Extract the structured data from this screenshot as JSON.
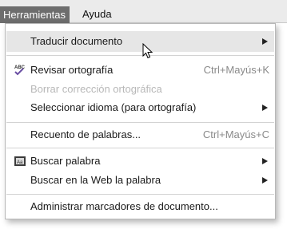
{
  "menubar": {
    "items": [
      {
        "label": "Herramientas"
      },
      {
        "label": "Ayuda"
      }
    ]
  },
  "menu": {
    "items": [
      {
        "label": "Traducir documento",
        "shortcut": "",
        "submenu": true,
        "disabled": false,
        "highlighted": true,
        "icon": ""
      },
      {
        "label": "Revisar ortografía",
        "shortcut": "Ctrl+Mayús+K",
        "submenu": false,
        "disabled": false,
        "highlighted": false,
        "icon": "spellcheck-icon",
        "icon_text": "ABC"
      },
      {
        "label": "Borrar corrección ortográfica",
        "shortcut": "",
        "submenu": false,
        "disabled": true,
        "highlighted": false,
        "icon": ""
      },
      {
        "label": "Seleccionar idioma (para ortografía)",
        "shortcut": "",
        "submenu": true,
        "disabled": false,
        "highlighted": false,
        "icon": ""
      },
      {
        "label": "Recuento de palabras...",
        "shortcut": "Ctrl+Mayús+C",
        "submenu": false,
        "disabled": false,
        "highlighted": false,
        "icon": ""
      },
      {
        "label": "Buscar palabra",
        "shortcut": "",
        "submenu": true,
        "disabled": false,
        "highlighted": false,
        "icon": "dictionary-icon",
        "icon_text": "Aa"
      },
      {
        "label": "Buscar en la Web la palabra",
        "shortcut": "",
        "submenu": true,
        "disabled": false,
        "highlighted": false,
        "icon": ""
      },
      {
        "label": "Administrar marcadores de documento...",
        "shortcut": "",
        "submenu": false,
        "disabled": false,
        "highlighted": false,
        "icon": ""
      }
    ]
  },
  "colors": {
    "menubar_bg": "#ebebeb",
    "active_menu_bg": "#6d6d6d",
    "hover_bg": "#e6e6e6",
    "disabled_text": "#b8b8b8",
    "shortcut_text": "#8a8a8a"
  }
}
